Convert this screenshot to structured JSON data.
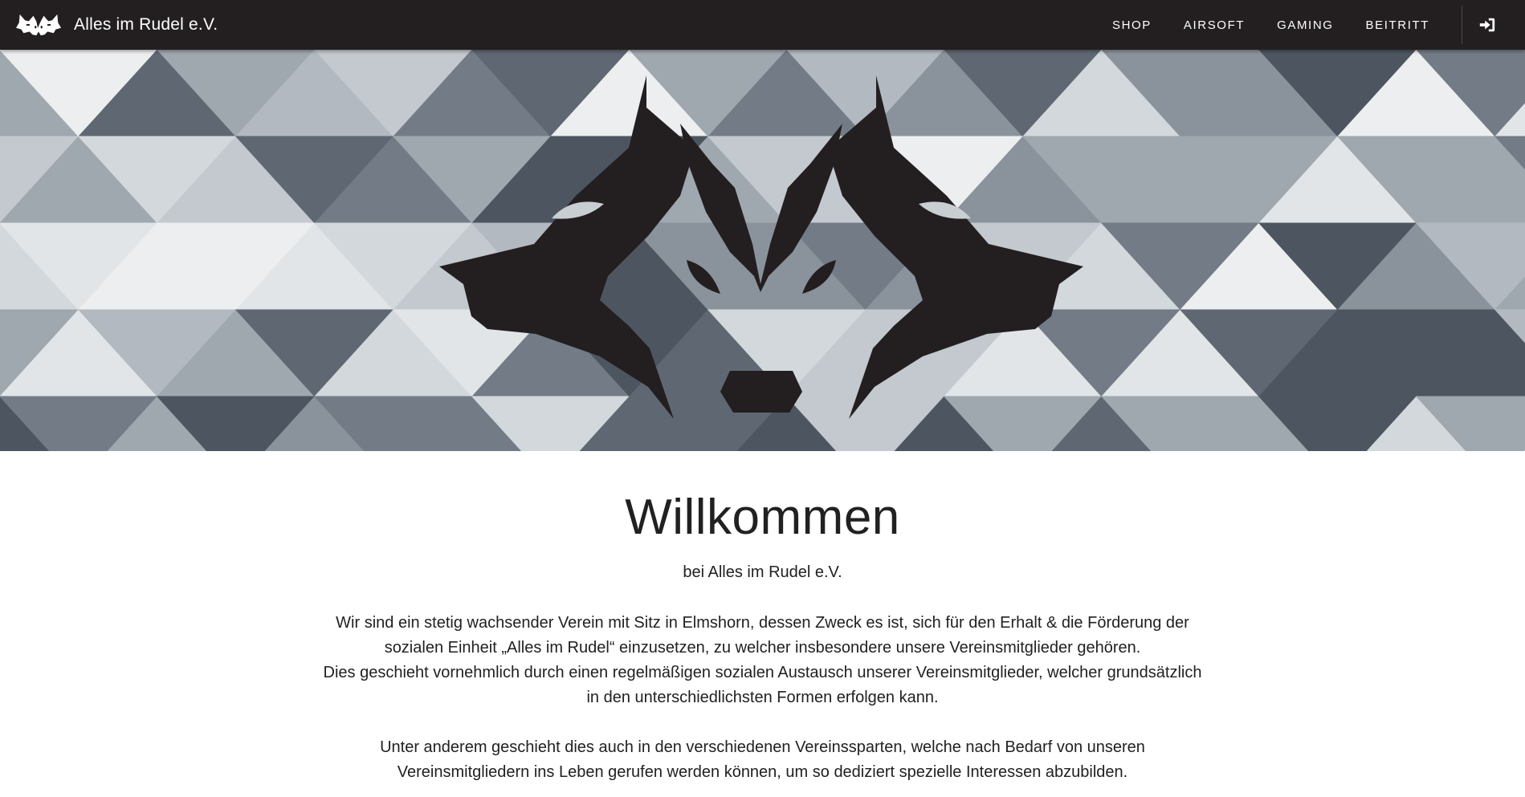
{
  "nav": {
    "brand": "Alles im Rudel e.V.",
    "brand_logo_icon": "wolf-logo-icon",
    "links": [
      "SHOP",
      "AIRSOFT",
      "GAMING",
      "BEITRITT"
    ],
    "login_icon": "sign-in-icon"
  },
  "hero": {
    "logo_icon": "wolf-pack-logo-icon"
  },
  "welcome": {
    "title": "Willkommen",
    "subtitle": "bei Alles im Rudel e.V.",
    "paragraph_1": [
      "Wir sind ein stetig wachsender Verein mit Sitz in Elmshorn, dessen Zweck es ist, sich für den Erhalt & die Förderung der",
      "sozialen Einheit „Alles im Rudel“ einzusetzen, zu welcher insbesondere unsere Vereinsmitglieder gehören.",
      "Dies geschieht vornehmlich durch einen regelmäßigen sozialen Austausch unserer Vereinsmitglieder, welcher grundsätzlich",
      "in den unterschiedlichsten Formen erfolgen kann."
    ],
    "paragraph_2": [
      "Unter anderem geschieht dies auch in den verschiedenen Vereinssparten, welche nach Bedarf von unseren",
      "Vereinsmitgliedern ins Leben gerufen werden können, um so dediziert spezielle Interessen abzubilden."
    ]
  },
  "colors": {
    "navbar": "#231f20",
    "logo": "#231f20",
    "text": "#212121"
  }
}
